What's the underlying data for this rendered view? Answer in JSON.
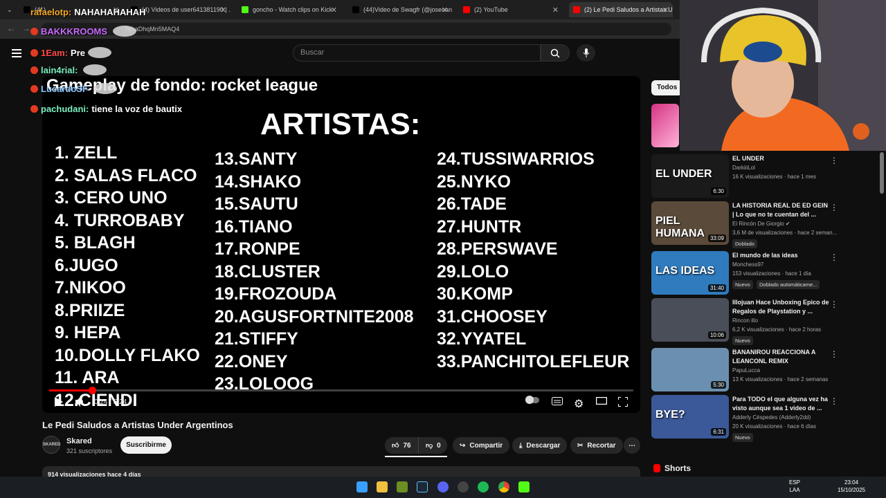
{
  "browser": {
    "tabs": [
      {
        "label": "(41) ...",
        "color": "#000000"
      },
      {
        "label": "(4) Videos de user641381190 | ...",
        "color": "#000000"
      },
      {
        "label": "goncho - Watch clips on Kick",
        "color": "#53fc18"
      },
      {
        "label": "(44)Video de Swagfr (@joseoan...",
        "color": "#000000"
      },
      {
        "label": "(2) YouTube",
        "color": "#ff0000"
      },
      {
        "label": "(2) Le Pedi Saludos a Artistas Un...",
        "color": "#ff0000"
      }
    ],
    "url": "?v=aDhqMn5MAQ4"
  },
  "youtube": {
    "search_placeholder": "Buscar",
    "video": {
      "overlay_title": "Gameplay de fondo: rocket league",
      "heading": "ARTISTAS:",
      "col1": [
        "1. ZELL",
        "2. SALAS FLACO",
        "3. CERO UNO",
        "4. TURROBABY",
        "5. BLAGH",
        "6.JUGO",
        "7.NIKOO",
        "8.PRIIZE",
        "9. HEPA",
        "10.DOLLY FLAKO",
        "11. ARA",
        "12.CIENDI"
      ],
      "col2": [
        "13.SANTY",
        "14.SHAKO",
        "15.SAUTU",
        "16.TIANO",
        "17.RONPE",
        "18.CLUSTER",
        "19.FROZOUDA",
        "20.AGUSFORTNITE2008",
        "21.STIFFY",
        "22.ONEY",
        "23.LOLOOG"
      ],
      "col3": [
        "24.TUSSIWARRIOS",
        "25.NYKO",
        "26.TADE",
        "27.HUNTR",
        "28.PERSWAVE",
        "29.LOLO",
        "30.KOMP",
        "31.CHOOSEY",
        "32.YYATEL",
        "33.PANCHITOLEFLEUR"
      ],
      "time": "0:24 / 5:24",
      "progress": 0.074
    },
    "title": "Le Pedi Saludos a Artistas Under Argentinos",
    "channel": {
      "avatar_text": "SKARED",
      "name": "Skared",
      "subs": "321 suscriptores",
      "subscribe": "Suscribirme"
    },
    "actions": {
      "likes": "76",
      "dislikes": "0",
      "share": "Compartir",
      "download": "Descargar",
      "clip": "Recortar"
    },
    "description": "914 visualizaciones  hace 4 días",
    "sidebar": {
      "chip": "Todos",
      "items": [
        {
          "thumb": "EL UNDER",
          "title": "EL UNDER",
          "channel": "DarkiiiLol",
          "meta": "16 K visualizaciones · hace 1 mes",
          "duration": "6:30",
          "color": "#1a1a1a"
        },
        {
          "thumb": "PIEL HUMANA",
          "title": "LA HISTORIA REAL DE ED GEIN | Lo que no te cuentan del ...",
          "channel": "El Rincón De Giorgio ✔",
          "meta": "3,6 M de visualizaciones · hace 2 seman...",
          "duration": "33:09",
          "badge": "Doblado",
          "color": "#5a4a3a"
        },
        {
          "thumb": "LAS IDEAS",
          "title": "El mundo de las ideas",
          "channel": "Monchess97",
          "meta": "153 visualizaciones · hace 1 día",
          "duration": "31:40",
          "badge": "Nuevo",
          "badge2": "Doblado automáticame...",
          "color": "#2f7bbd"
        },
        {
          "thumb": "",
          "title": "Illojuan Hace Unboxing Epico de Regalos de Playstation y ...",
          "channel": "Rincon illo",
          "meta": "6,2 K visualizaciones · hace 2 horas",
          "duration": "10:06",
          "badge": "Nuevo",
          "color": "#4a4e58"
        },
        {
          "thumb": "",
          "title": "BANANIROU REACCIONA  A LEANCONL REMIX",
          "channel": "PapuLucca",
          "meta": "13 K visualizaciones · hace 2 semanas",
          "duration": "5:30",
          "color": "#6b8fb0"
        },
        {
          "thumb": "BYE?",
          "title": "Para TODO el que alguna vez ha visto aunque sea 1 video de ...",
          "channel": "Adderly Céspedes (Adderly2dd)",
          "meta": "20 K visualizaciones · hace 6 días",
          "duration": "6:31",
          "badge": "Nuevo",
          "color": "#3b5998"
        }
      ],
      "shorts": "Shorts"
    }
  },
  "chat": [
    {
      "user": "rafaelotp:",
      "msg": "NAHAHAHAHAH",
      "color": "#f5a623"
    },
    {
      "user": "BAKKKROOMS",
      "msg": "",
      "color": "#c86bff"
    },
    {
      "user": "1Eam:",
      "msg": "Pre",
      "color": "#ff4a4a"
    },
    {
      "user": "lain4rial:",
      "msg": "",
      "color": "#7cf0c0"
    },
    {
      "user": "LucardoSF",
      "msg": "",
      "color": "#8ac6ff"
    },
    {
      "user": "pachudani:",
      "msg": "tiene la voz de bautix",
      "color": "#7cf0c0"
    }
  ],
  "taskbar": {
    "lang": "ESP\nLAA",
    "time": "23:04",
    "date": "15/10/2025"
  }
}
